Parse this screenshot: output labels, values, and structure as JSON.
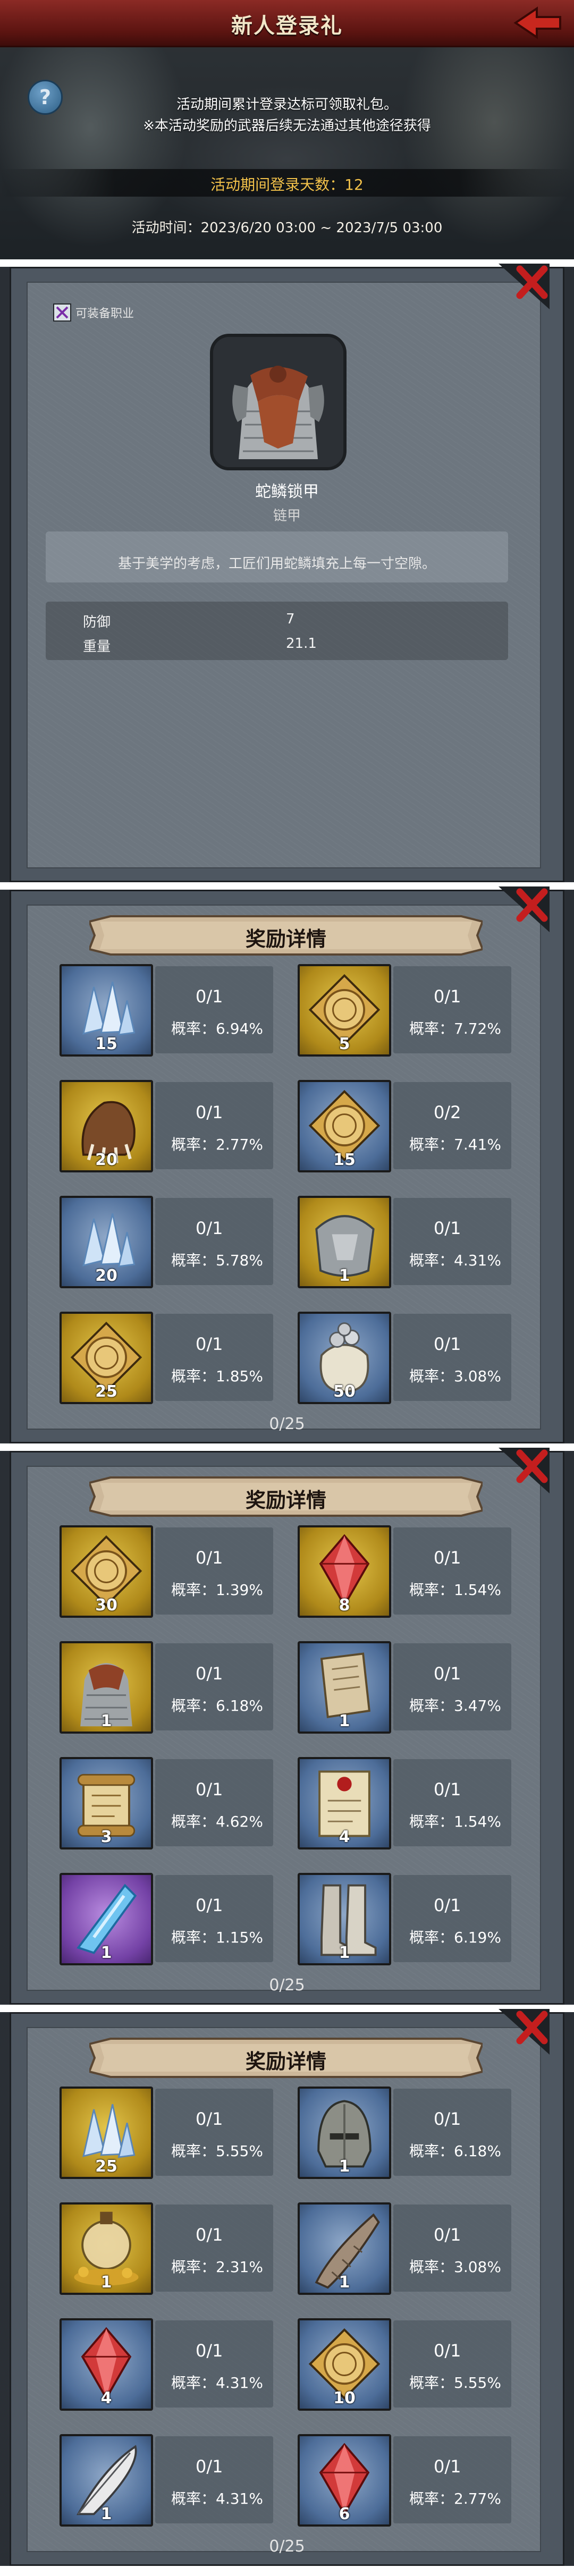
{
  "banner": {
    "title": "新人登录礼",
    "help_icon": "?",
    "line1": "活动期间累计登录达标可领取礼包。",
    "line2": "※本活动奖励的武器后续无法通过其他途径获得",
    "days": "活动期间登录天数：12",
    "time": "活动时间：2023/6/20 03:00 ~ 2023/7/5 03:00",
    "colors": {
      "title_bar": "#7a1f1b",
      "days": "#f2c14a"
    }
  },
  "item_detail": {
    "job_label": "可装备职业",
    "name": "蛇鳞锁甲",
    "type": "链甲",
    "description": "基于美学的考虑，工匠们用蛇鳞填充上每一寸空隙。",
    "stats": [
      {
        "label": "防御",
        "value": "7"
      },
      {
        "label": "重量",
        "value": "21.1"
      }
    ]
  },
  "reward_panels": [
    {
      "title": "奖励详情",
      "progress": "0/25",
      "items": [
        {
          "icon": "blue-crystal-icon",
          "rarity": "b",
          "count": "15",
          "fraction": "0/1",
          "prob": "概率：6.94%"
        },
        {
          "icon": "gold-medallion-icon",
          "rarity": "y",
          "count": "5",
          "fraction": "0/1",
          "prob": "概率：7.72%"
        },
        {
          "icon": "beast-claw-icon",
          "rarity": "y",
          "count": "20",
          "fraction": "0/1",
          "prob": "概率：2.77%"
        },
        {
          "icon": "gold-medallion-icon",
          "rarity": "b",
          "count": "15",
          "fraction": "0/2",
          "prob": "概率：7.41%"
        },
        {
          "icon": "blue-crystal-icon",
          "rarity": "b",
          "count": "20",
          "fraction": "0/1",
          "prob": "概率：5.78%"
        },
        {
          "icon": "shoulder-armor-icon",
          "rarity": "y",
          "count": "1",
          "fraction": "0/1",
          "prob": "概率：4.31%"
        },
        {
          "icon": "gold-medallion-icon",
          "rarity": "y",
          "count": "25",
          "fraction": "0/1",
          "prob": "概率：1.85%"
        },
        {
          "icon": "silver-coin-bag-icon",
          "rarity": "b",
          "count": "50",
          "fraction": "0/1",
          "prob": "概率：3.08%"
        }
      ]
    },
    {
      "title": "奖励详情",
      "progress": "0/25",
      "items": [
        {
          "icon": "gold-medallion-icon",
          "rarity": "y",
          "count": "30",
          "fraction": "0/1",
          "prob": "概率：1.39%"
        },
        {
          "icon": "red-gem-icon",
          "rarity": "y",
          "count": "8",
          "fraction": "0/1",
          "prob": "概率：1.54%"
        },
        {
          "icon": "scale-armor-icon",
          "rarity": "y",
          "count": "1",
          "fraction": "0/1",
          "prob": "概率：6.18%"
        },
        {
          "icon": "map-scroll-icon",
          "rarity": "b",
          "count": "1",
          "fraction": "0/1",
          "prob": "概率：3.47%"
        },
        {
          "icon": "scroll-icon",
          "rarity": "b",
          "count": "3",
          "fraction": "0/1",
          "prob": "概率：4.62%"
        },
        {
          "icon": "sealed-letter-icon",
          "rarity": "b",
          "count": "4",
          "fraction": "0/1",
          "prob": "概率：1.54%"
        },
        {
          "icon": "ice-shard-icon",
          "rarity": "p",
          "count": "1",
          "fraction": "0/1",
          "prob": "概率：1.15%"
        },
        {
          "icon": "boots-icon",
          "rarity": "b",
          "count": "1",
          "fraction": "0/1",
          "prob": "概率：6.19%"
        }
      ]
    },
    {
      "title": "奖励详情",
      "progress": "0/25",
      "items": [
        {
          "icon": "blue-crystal-icon",
          "rarity": "y",
          "count": "25",
          "fraction": "0/1",
          "prob": "概率：5.55%"
        },
        {
          "icon": "iron-helmet-icon",
          "rarity": "b",
          "count": "1",
          "fraction": "0/1",
          "prob": "概率：6.18%"
        },
        {
          "icon": "potion-gold-icon",
          "rarity": "y",
          "count": "1",
          "fraction": "0/1",
          "prob": "概率：2.31%"
        },
        {
          "icon": "horn-icon",
          "rarity": "b",
          "count": "1",
          "fraction": "0/1",
          "prob": "概率：3.08%"
        },
        {
          "icon": "red-gem-icon",
          "rarity": "b",
          "count": "4",
          "fraction": "0/1",
          "prob": "概率：4.31%"
        },
        {
          "icon": "gold-medallion-icon",
          "rarity": "b",
          "count": "10",
          "fraction": "0/1",
          "prob": "概率：5.55%"
        },
        {
          "icon": "feather-icon",
          "rarity": "b",
          "count": "1",
          "fraction": "0/1",
          "prob": "概率：4.31%"
        },
        {
          "icon": "red-gem-icon",
          "rarity": "b",
          "count": "6",
          "fraction": "0/1",
          "prob": "概率：2.77%"
        }
      ]
    }
  ]
}
